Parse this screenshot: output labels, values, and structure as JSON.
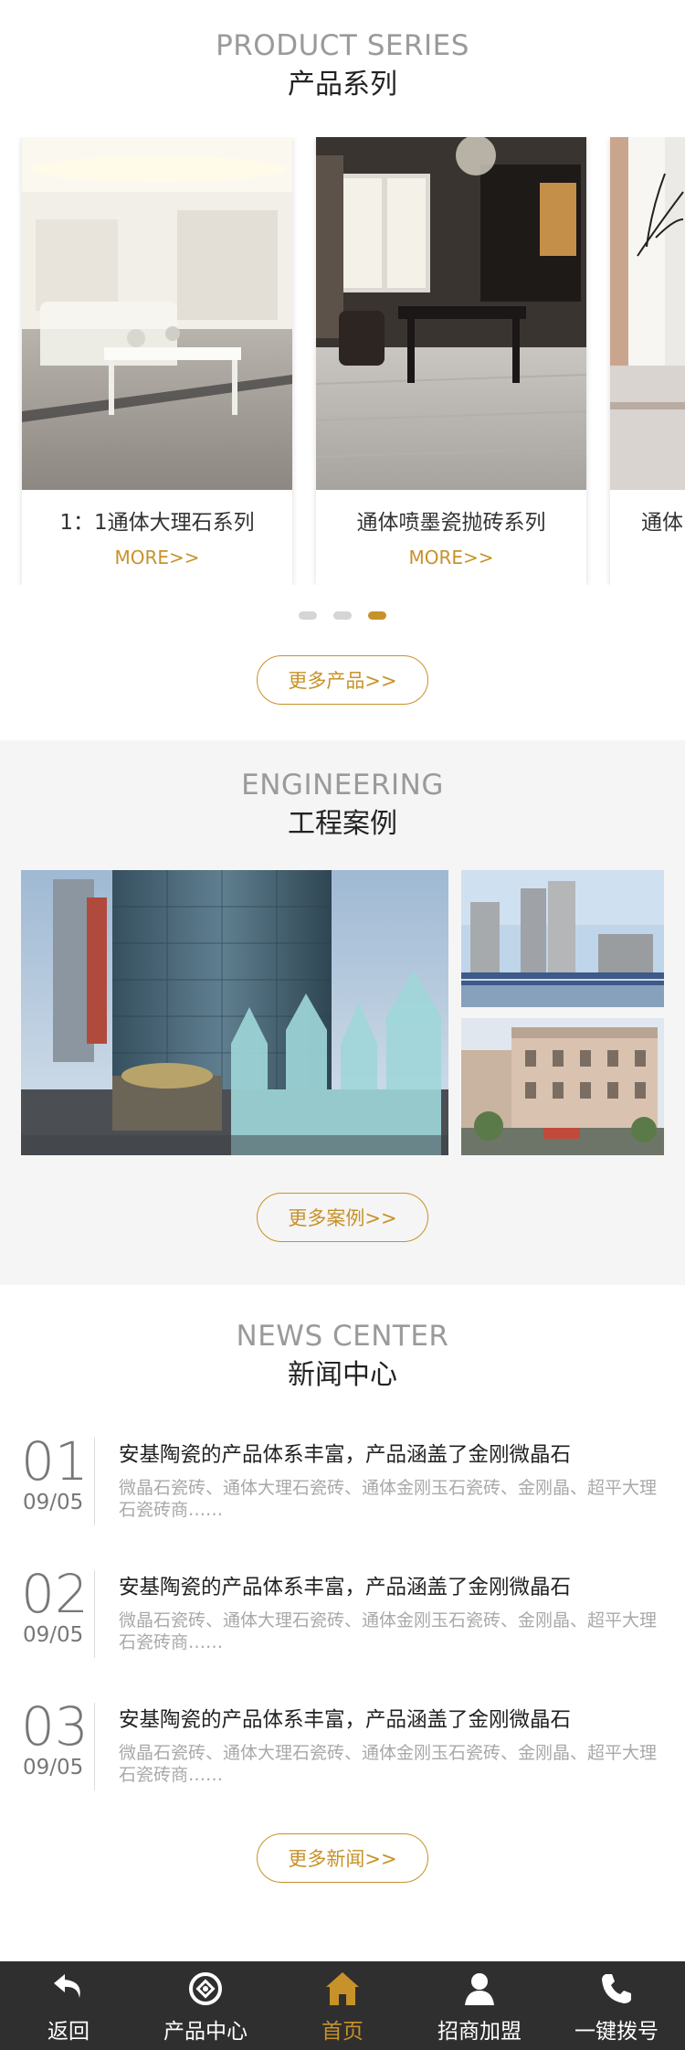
{
  "products": {
    "title_en": "PRODUCT SERIES",
    "title_cn": "产品系列",
    "items": [
      {
        "name": "1：1通体大理石系列",
        "more": "MORE>>"
      },
      {
        "name": "通体喷墨瓷抛砖系列",
        "more": "MORE>>"
      },
      {
        "name": "通体"
      }
    ],
    "pager": {
      "count": 3,
      "active_index": 3
    },
    "more_button": "更多产品>>"
  },
  "engineering": {
    "title_en": "ENGINEERING",
    "title_cn": "工程案例",
    "more_button": "更多案例>>"
  },
  "news": {
    "title_en": "NEWS CENTER",
    "title_cn": "新闻中心",
    "items": [
      {
        "num": "01",
        "date": "09/05",
        "title": "安基陶瓷的产品体系丰富，产品涵盖了金刚微晶石",
        "summary": "微晶石瓷砖、通体大理石瓷砖、通体金刚玉石瓷砖、金刚晶、超平大理石瓷砖商……"
      },
      {
        "num": "02",
        "date": "09/05",
        "title": "安基陶瓷的产品体系丰富，产品涵盖了金刚微晶石",
        "summary": "微晶石瓷砖、通体大理石瓷砖、通体金刚玉石瓷砖、金刚晶、超平大理石瓷砖商……"
      },
      {
        "num": "03",
        "date": "09/05",
        "title": "安基陶瓷的产品体系丰富，产品涵盖了金刚微晶石",
        "summary": "微晶石瓷砖、通体大理石瓷砖、通体金刚玉石瓷砖、金刚晶、超平大理石瓷砖商……"
      }
    ],
    "more_button": "更多新闻>>"
  },
  "bottom_nav": {
    "items": [
      {
        "label": "返回",
        "icon": "back-arrow-icon"
      },
      {
        "label": "产品中心",
        "icon": "product-center-icon"
      },
      {
        "label": "首页",
        "icon": "home-icon"
      },
      {
        "label": "招商加盟",
        "icon": "user-icon"
      },
      {
        "label": "一键拨号",
        "icon": "phone-icon"
      }
    ],
    "active_label": "首页"
  },
  "colors": {
    "accent": "#c7922a",
    "nav_bg": "#2f2f2f",
    "section_alt_bg": "#f5f5f5"
  }
}
